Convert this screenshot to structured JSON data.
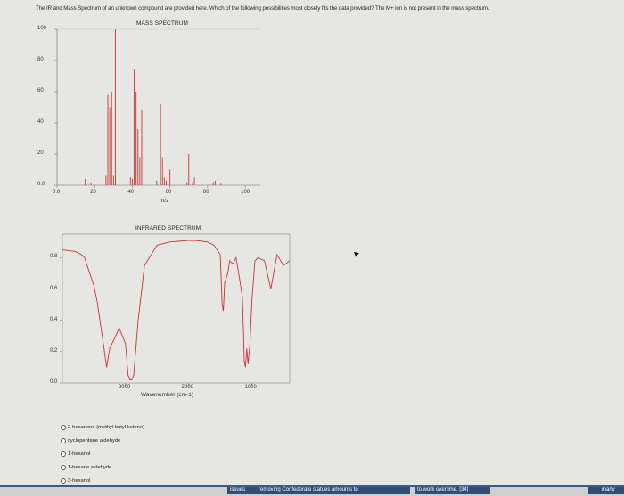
{
  "question": "The IR and Mass Spectrum of an unknown compound are provided here. Which of the following possibilities most closely fits the data provided? The M+ ion is not present in the mass spectrum.",
  "mass_spectrum": {
    "title": "MASS SPECTRUM",
    "xlabel": "m/z",
    "x_ticks": [
      "0.0",
      "20",
      "40",
      "60",
      "80",
      "100"
    ],
    "y_ticks": [
      "100",
      "80",
      "60",
      "40",
      "20",
      "0.0"
    ]
  },
  "infrared_spectrum": {
    "title": "INFRARED SPECTRUM",
    "xlabel": "Wavenumber (cm-1)",
    "x_ticks": [
      "3000",
      "2000",
      "1000"
    ],
    "y_ticks": [
      "0.8",
      "0.6",
      "0.4",
      "0.2",
      "0.0"
    ]
  },
  "options": [
    "2-hexanone (methyl butyl ketone)",
    "cyclopentane aldehyde",
    "1-hexanol",
    "1-hexane aldehyde",
    "3-hexanol"
  ],
  "bottom_bar": {
    "seg1": "issues",
    "seg2": "removing Confederate statues amounts to",
    "seg3": "to work overtime. [34]",
    "seg4": "many"
  },
  "chart_data": [
    {
      "type": "bar",
      "title": "MASS SPECTRUM",
      "xlabel": "m/z",
      "ylabel": "",
      "xlim": [
        0,
        108
      ],
      "ylim": [
        0,
        100
      ],
      "x": [
        15,
        18,
        26,
        27,
        28,
        29,
        30,
        31,
        39,
        40,
        41,
        42,
        43,
        44,
        45,
        53,
        55,
        56,
        57,
        58,
        59,
        60,
        69,
        70,
        72,
        73,
        83,
        84,
        87
      ],
      "values": [
        4,
        2,
        6,
        58,
        50,
        60,
        6,
        100,
        5,
        4,
        74,
        60,
        36,
        18,
        48,
        3,
        52,
        18,
        5,
        3,
        100,
        10,
        2,
        20,
        2,
        5,
        2,
        3,
        1
      ]
    },
    {
      "type": "line",
      "title": "INFRARED SPECTRUM",
      "xlabel": "Wavenumber (cm-1)",
      "ylabel": "",
      "xlim": [
        4000,
        400
      ],
      "ylim": [
        0,
        0.95
      ],
      "x": [
        4000,
        3800,
        3700,
        3650,
        3500,
        3450,
        3350,
        3300,
        3250,
        3100,
        3000,
        2960,
        2930,
        2900,
        2870,
        2800,
        2700,
        2500,
        2300,
        2000,
        1900,
        1700,
        1600,
        1500,
        1470,
        1450,
        1430,
        1380,
        1350,
        1300,
        1250,
        1200,
        1150,
        1130,
        1120,
        1100,
        1080,
        1060,
        1030,
        1000,
        950,
        900,
        800,
        700,
        600,
        500,
        400
      ],
      "values": [
        0.85,
        0.84,
        0.82,
        0.8,
        0.62,
        0.52,
        0.25,
        0.1,
        0.22,
        0.35,
        0.25,
        0.05,
        0.02,
        0.02,
        0.05,
        0.4,
        0.75,
        0.88,
        0.9,
        0.91,
        0.91,
        0.9,
        0.88,
        0.82,
        0.5,
        0.46,
        0.64,
        0.7,
        0.78,
        0.76,
        0.8,
        0.68,
        0.55,
        0.3,
        0.14,
        0.1,
        0.22,
        0.12,
        0.25,
        0.52,
        0.78,
        0.8,
        0.78,
        0.6,
        0.82,
        0.75,
        0.78
      ]
    }
  ]
}
